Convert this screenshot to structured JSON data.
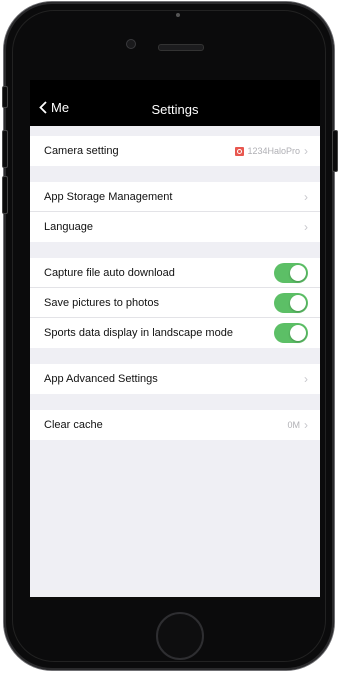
{
  "navbar": {
    "back_label": "Me",
    "title": "Settings"
  },
  "camera": {
    "label": "Camera setting",
    "device_name": "1234HaloPro"
  },
  "storage": {
    "label": "App Storage Management"
  },
  "language": {
    "label": "Language"
  },
  "toggles": {
    "auto_download": {
      "label": "Capture file auto download",
      "on": true
    },
    "save_pictures": {
      "label": "Save pictures to photos",
      "on": true
    },
    "landscape": {
      "label": "Sports data display in landscape mode",
      "on": true
    }
  },
  "advanced": {
    "label": "App Advanced Settings"
  },
  "cache": {
    "label": "Clear cache",
    "size": "0M"
  },
  "colors": {
    "toggle_on": "#5cbf66",
    "navbar": "#000000",
    "badge": "#e8574f"
  }
}
